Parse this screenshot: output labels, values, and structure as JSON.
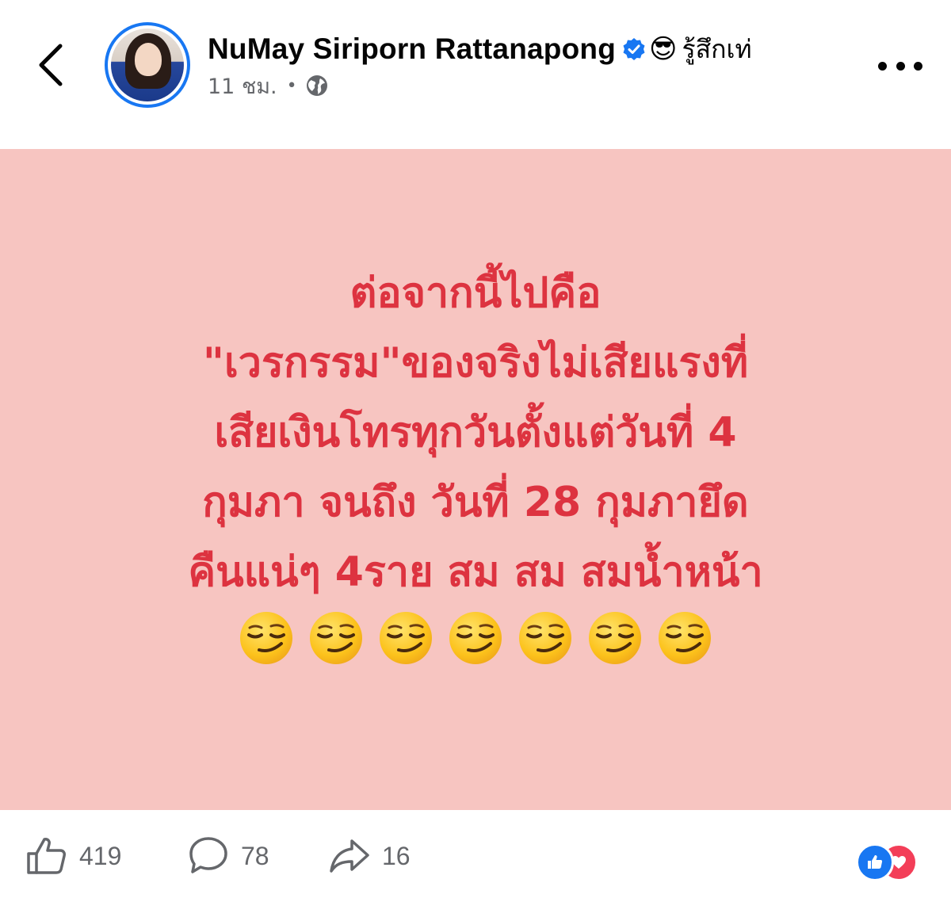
{
  "header": {
    "author_name": "NuMay Siriporn Rattanapong",
    "feeling_emoji": "😎",
    "feeling_text": "รู้สึกเท่",
    "timestamp": "11 ชม.",
    "separator": "•",
    "audience_icon": "globe-icon",
    "back_icon": "chevron-left-icon",
    "more_icon": "more-horizontal-icon",
    "verified_icon": "verified-badge-icon"
  },
  "post": {
    "background_color": "#f7c5c1",
    "text_color": "#dd3340",
    "lines": [
      "ต่อจากนี้ไปคือ",
      "\"เวรกรรม\"ของจริงไม่เสียแรงที่",
      "เสียเงินโทรทุกวันตั้งแต่วันที่ 4",
      "กุมภา จนถึง วันที่ 28 กุมภายึด",
      "คืนแน่ๆ 4ราย สม สม สมน้ำหน้า"
    ],
    "emoji_count": 7,
    "emoji_icon": "smirking-face-icon"
  },
  "footer": {
    "likes": "419",
    "comments": "78",
    "shares": "16",
    "reactions": [
      "like-reaction-icon",
      "love-reaction-icon"
    ]
  },
  "colors": {
    "brand_blue": "#1877f2",
    "love_red": "#f33e58",
    "secondary_text": "#65676b"
  }
}
